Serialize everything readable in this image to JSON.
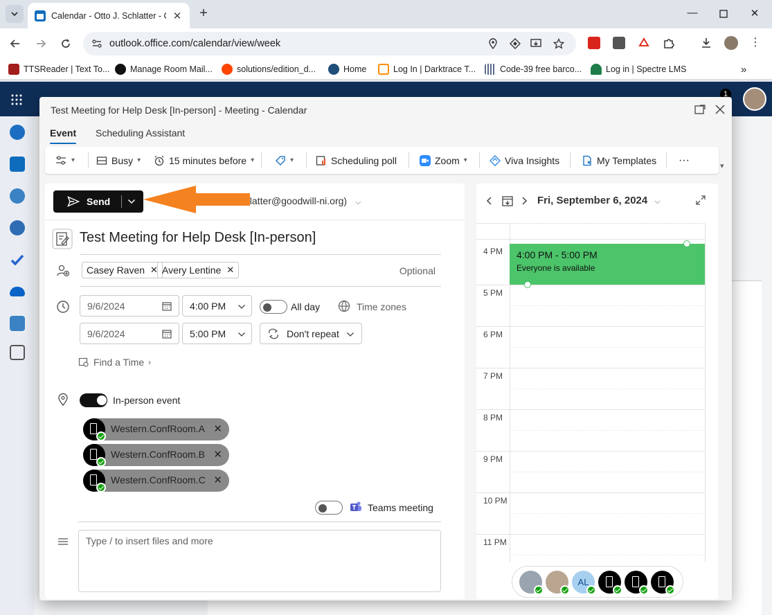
{
  "browser": {
    "tab_title": "Calendar - Otto J. Schlatter - Ou",
    "url": "outlook.office.com/calendar/view/week",
    "bookmarks": [
      {
        "label": "TTSReader | Text To...",
        "color": "#c0392b"
      },
      {
        "label": "Manage Room Mail...",
        "color": "#111111"
      },
      {
        "label": "solutions/edition_d...",
        "color": "#ff4500"
      },
      {
        "label": "Home",
        "color": "#1f4e79"
      },
      {
        "label": "Log In | Darktrace T...",
        "color": "#ff8c00"
      },
      {
        "label": "Code-39 free barco...",
        "color": "#5b6b8c"
      },
      {
        "label": "Log in | Spectre LMS",
        "color": "#1e7d4a"
      }
    ],
    "notification_count": "1"
  },
  "dialog": {
    "title": "Test Meeting for Help Desk [In-person] - Meeting - Calendar",
    "tabs": [
      "Event",
      "Scheduling Assistant"
    ],
    "active_tab": "Event",
    "ribbon": {
      "busy": "Busy",
      "reminder": "15 minutes before",
      "scheduling_poll": "Scheduling poll",
      "zoom": "Zoom",
      "viva": "Viva Insights",
      "templates": "My Templates",
      "more": "···"
    },
    "send_label": "Send",
    "from_text": "hlatter@goodwill-ni.org)",
    "meeting_title": "Test Meeting for Help Desk [In-person]",
    "attendees": [
      "Casey Raven",
      "Avery Lentine"
    ],
    "optional_label": "Optional",
    "start_date": "9/6/2024",
    "start_time": "4:00 PM",
    "end_date": "9/6/2024",
    "end_time": "5:00 PM",
    "all_day_label": "All day",
    "time_zones_label": "Time zones",
    "repeat_label": "Don't repeat",
    "find_time_label": "Find a Time",
    "in_person_label": "In-person event",
    "rooms": [
      "Western.ConfRoom.A",
      "Western.ConfRoom.B",
      "Western.ConfRoom.C"
    ],
    "teams_label": "Teams meeting",
    "body_placeholder": "Type / to insert files and more"
  },
  "calendar": {
    "date": "Fri, September 6, 2024",
    "hours": [
      "4 PM",
      "5 PM",
      "6 PM",
      "7 PM",
      "8 PM",
      "9 PM",
      "10 PM",
      "11 PM"
    ],
    "event_time": "4:00 PM - 5:00 PM",
    "event_status": "Everyone is available",
    "avatar_initials": "AL"
  },
  "colors": {
    "accent": "#0f6cbd",
    "event_green": "#4cc46a",
    "annotation_orange": "#f58220",
    "outlook_header": "#0f2e57"
  }
}
